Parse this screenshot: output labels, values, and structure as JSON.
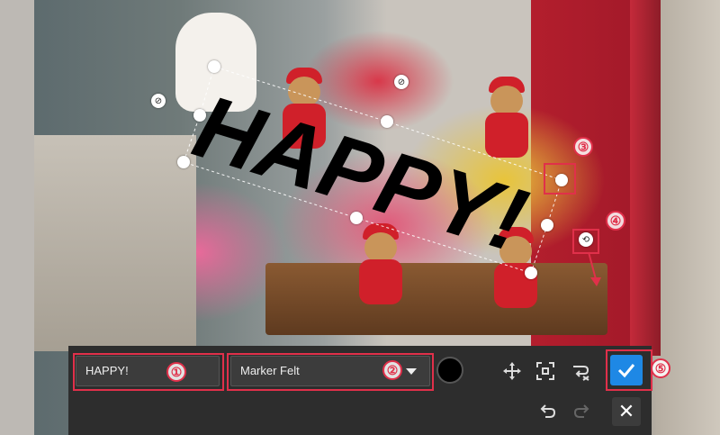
{
  "overlay_text": "HAPPY!",
  "toolbar": {
    "text_value": "HAPPY!",
    "font_name": "Marker Felt",
    "text_color": "#000000",
    "confirm_icon": "check-icon",
    "cancel_icon": "close-icon"
  },
  "callouts": [
    "①",
    "②",
    "③",
    "④",
    "⑤"
  ],
  "colors": {
    "accent": "#1e88e5",
    "callout": "#e0304a",
    "toolbar_bg": "#2d2d2d"
  }
}
